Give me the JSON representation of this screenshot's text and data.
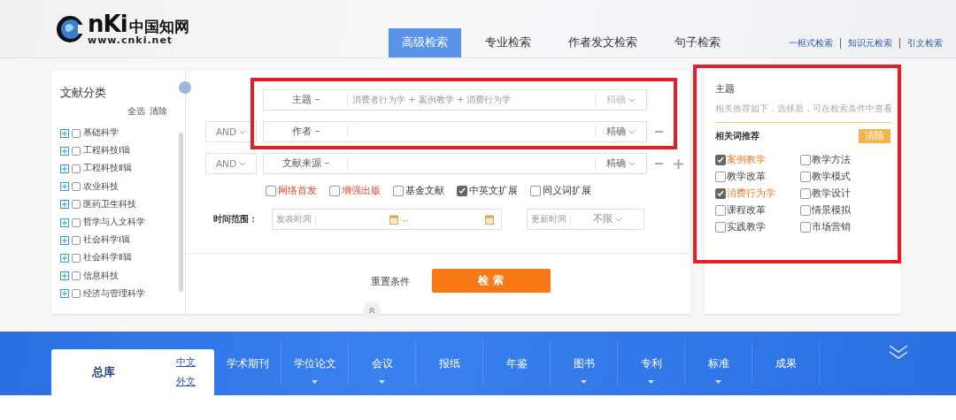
{
  "logo": {
    "mark": "nKi",
    "cn": "中国知网",
    "url": "www.cnki.net"
  },
  "search_tabs": [
    {
      "label": "高级检索",
      "selected": true
    },
    {
      "label": "专业检索",
      "selected": false
    },
    {
      "label": "作者发文检索",
      "selected": false
    },
    {
      "label": "句子检索",
      "selected": false
    }
  ],
  "header_links": [
    "一框式检索",
    "知识元检索",
    "引文检索"
  ],
  "sidebar": {
    "title": "文献分类",
    "actions": [
      "全选",
      "清除"
    ],
    "items": [
      {
        "label": "基础科学",
        "checked": false
      },
      {
        "label": "工程科技Ⅰ辑",
        "checked": false
      },
      {
        "label": "工程科技Ⅱ辑",
        "checked": false
      },
      {
        "label": "农业科技",
        "checked": false
      },
      {
        "label": "医药卫生科技",
        "checked": false
      },
      {
        "label": "哲学与人文科学",
        "checked": false
      },
      {
        "label": "社会科学Ⅰ辑",
        "checked": false
      },
      {
        "label": "社会科学Ⅱ辑",
        "checked": false
      },
      {
        "label": "信息科技",
        "checked": false
      },
      {
        "label": "经济与管理科学",
        "checked": false
      }
    ]
  },
  "conditions": {
    "highlighted": true,
    "rows": [
      {
        "field": "主题",
        "value": "消费者行为学 + 案例教学 + 消费行为学",
        "match": "精确",
        "removable": false,
        "addable": false
      },
      {
        "operator": "AND",
        "field": "作者",
        "match": "精确",
        "removable": true,
        "addable": false
      },
      {
        "operator": "AND",
        "field": "文献来源",
        "match": "精确",
        "removable": true,
        "addable": true
      }
    ]
  },
  "options": [
    {
      "label": "网络首发",
      "checked": false,
      "emphasized": true
    },
    {
      "label": "增强出版",
      "checked": false,
      "emphasized": true
    },
    {
      "label": "基金文献",
      "checked": false,
      "emphasized": false
    },
    {
      "label": "中英文扩展",
      "checked": true,
      "emphasized": false
    },
    {
      "label": "同义词扩展",
      "checked": false,
      "emphasized": false
    }
  ],
  "time_range": {
    "label": "时间范围：",
    "publish_label": "发表时间",
    "separator": "--",
    "update_label": "更新时间",
    "update_value": "不限"
  },
  "reset_label": "重置条件",
  "search_button": "检 索",
  "recommend": {
    "highlighted": true,
    "title": "主题",
    "hint": "相关推荐如下，选择后，可在检索条件中查看",
    "heading": "相关词推荐",
    "clear": "清除",
    "terms": [
      {
        "label": "案例教学",
        "checked": true
      },
      {
        "label": "教学方法",
        "checked": false
      },
      {
        "label": "教学改革",
        "checked": false
      },
      {
        "label": "教学模式",
        "checked": false
      },
      {
        "label": "消费行为学",
        "checked": true
      },
      {
        "label": "教学设计",
        "checked": false
      },
      {
        "label": "课程改革",
        "checked": false
      },
      {
        "label": "情景模拟",
        "checked": false
      },
      {
        "label": "实践教学",
        "checked": false
      },
      {
        "label": "市场营销",
        "checked": false
      }
    ]
  },
  "databases": {
    "main": {
      "label": "总库",
      "selected": true
    },
    "languages": [
      "中文",
      "外文"
    ],
    "items": [
      {
        "label": "学术期刊",
        "dropdown": false
      },
      {
        "label": "学位论文",
        "dropdown": true
      },
      {
        "label": "会议",
        "dropdown": true
      },
      {
        "label": "报纸",
        "dropdown": false
      },
      {
        "label": "年鉴",
        "dropdown": false
      },
      {
        "label": "图书",
        "dropdown": true
      },
      {
        "label": "专利",
        "dropdown": true
      },
      {
        "label": "标准",
        "dropdown": true
      },
      {
        "label": "成果",
        "dropdown": false
      }
    ]
  }
}
